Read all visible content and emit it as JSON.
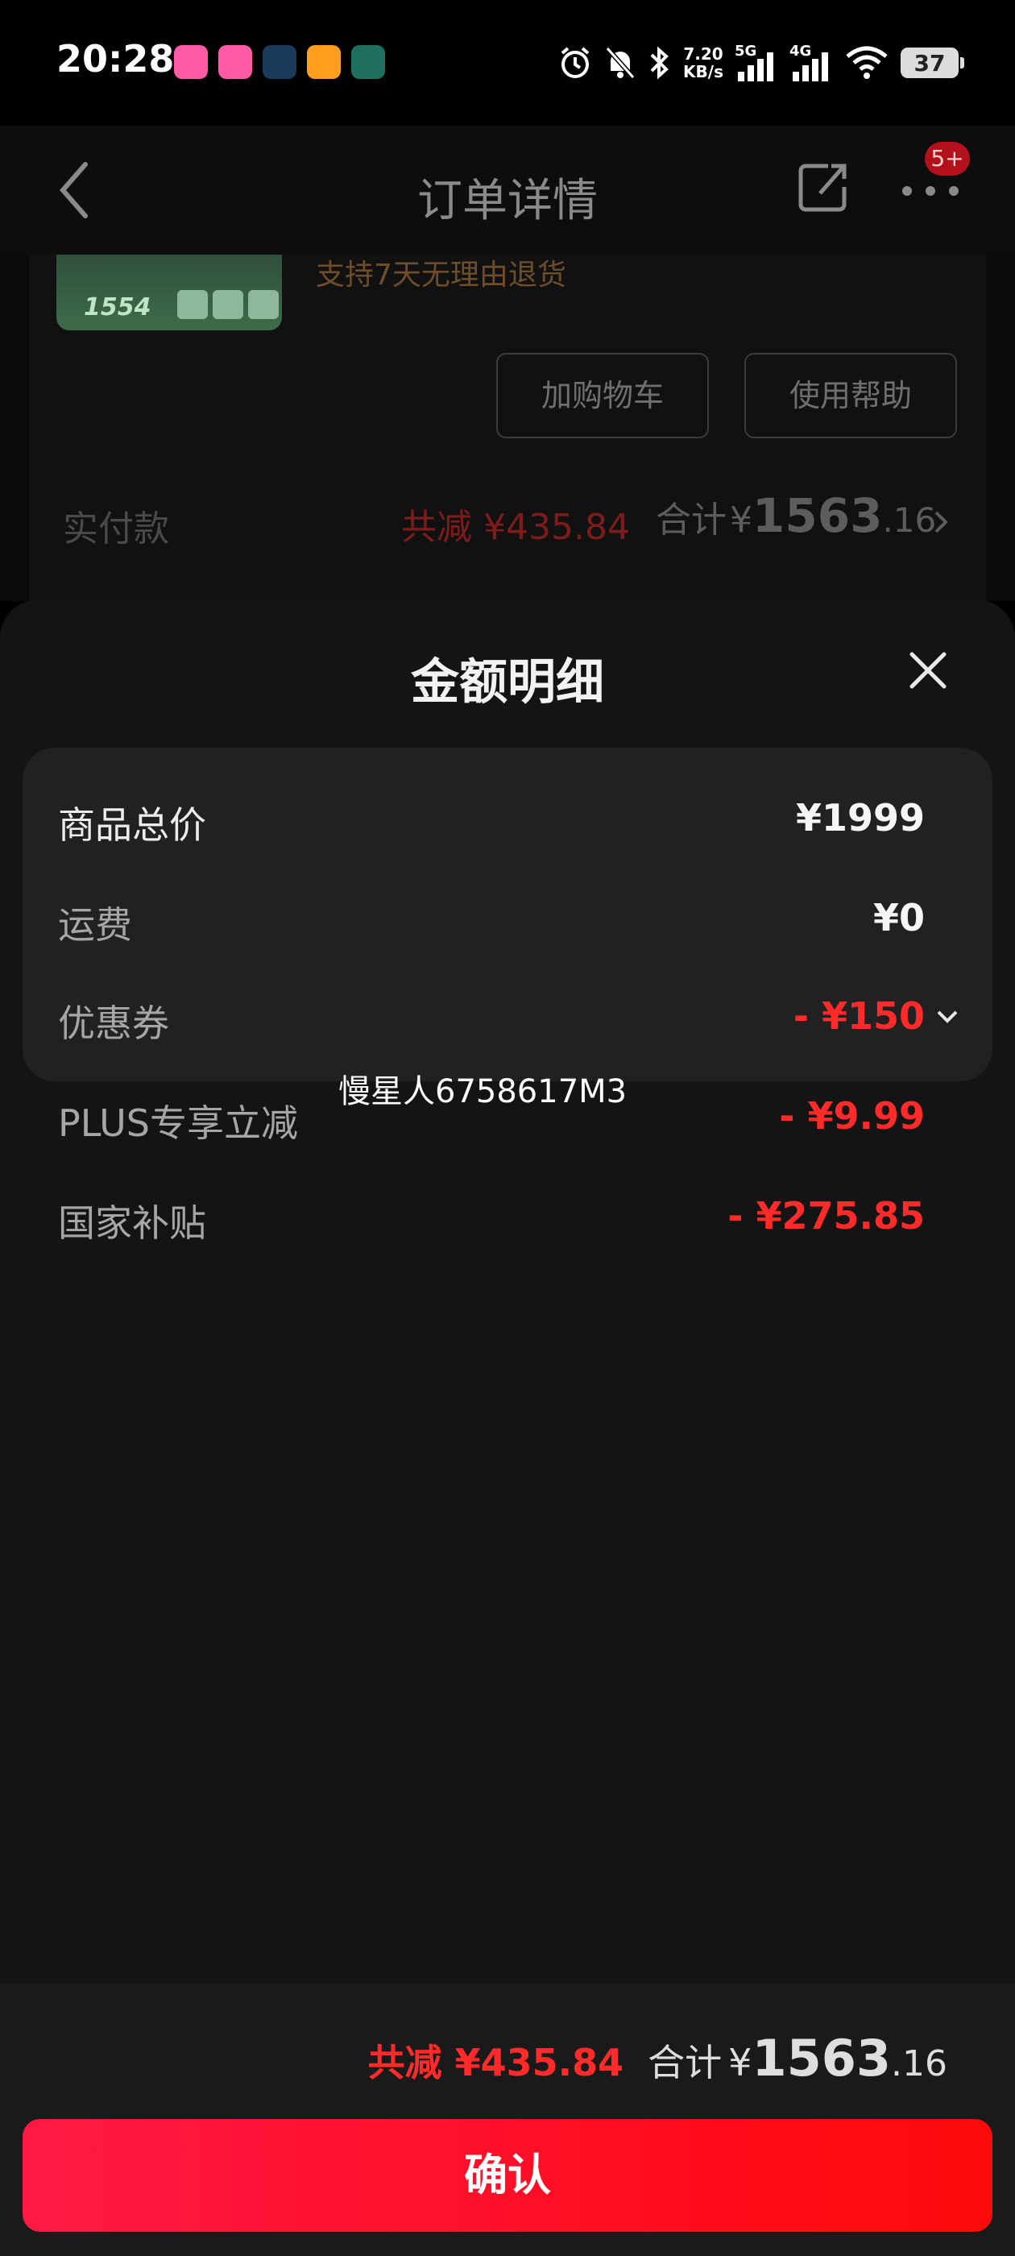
{
  "status_bar": {
    "time": "20:28",
    "speed_value": "7.20",
    "speed_unit": "KB/s",
    "net1": "5G",
    "net2": "4G",
    "battery": "37",
    "icons": [
      "alarm-icon",
      "mute-bell-icon",
      "bluetooth-icon",
      "signal-icon",
      "wifi-icon",
      "battery-icon"
    ]
  },
  "header": {
    "title": "订单详情",
    "badge": "5+"
  },
  "background_page": {
    "return_policy": "支持7天无理由退货",
    "product_price_tag": "1554",
    "add_to_cart": "加购物车",
    "help": "使用帮助",
    "paid_label": "实付款",
    "reduce": "共减 ¥435.84",
    "total_label": "合计",
    "total_yen": "¥",
    "total_int": "1563",
    "total_dec": ".16"
  },
  "sheet": {
    "title": "金额明细",
    "rows": [
      {
        "label": "商品总价",
        "value": "¥1999"
      },
      {
        "label": "运费",
        "value": "¥0"
      },
      {
        "label": "优惠券",
        "value": "- ¥150"
      },
      {
        "label": "PLUS专享立减",
        "value": "- ¥9.99"
      },
      {
        "label": "国家补贴",
        "value": "- ¥275.85"
      }
    ],
    "watermark": "慢星人6758617M3"
  },
  "bottom": {
    "reduce": "共减 ¥435.84",
    "total_label": "合计",
    "total_yen": "¥",
    "total_int": "1563",
    "total_dec": ".16",
    "confirm": "确认"
  },
  "colors": {
    "accent_red": "#ff2a2a",
    "confirm_gradient_start": "#ff1945",
    "confirm_gradient_end": "#ff0a0a"
  }
}
